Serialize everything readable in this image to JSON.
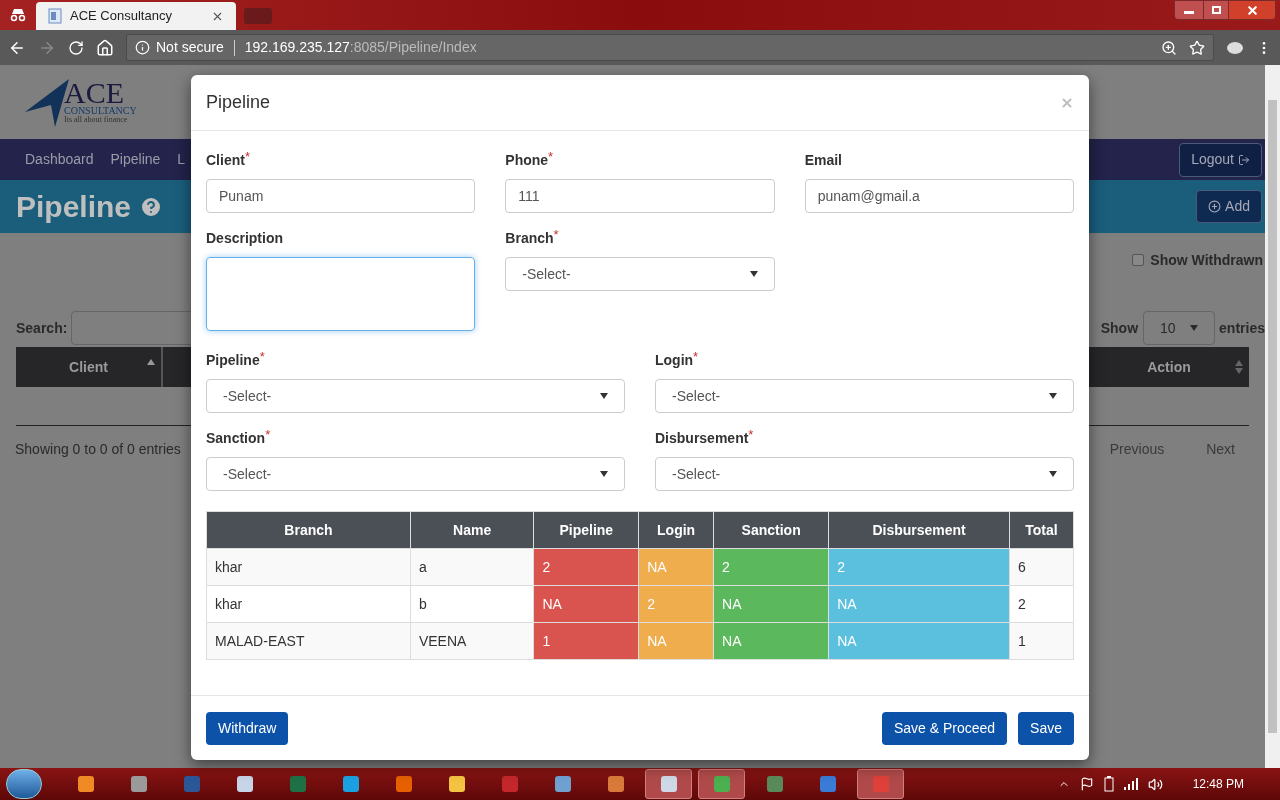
{
  "browser": {
    "tab_title": "ACE Consultancy",
    "security": "Not secure",
    "url_host": "192.169.235.127",
    "url_rest": ":8085/Pipeline/Index"
  },
  "page": {
    "logo": {
      "name": "ACE",
      "sub": "CONSULTANCY",
      "tagline": "Its all about finance"
    },
    "nav": [
      {
        "label": "Dashboard"
      },
      {
        "label": "Pipeline"
      },
      {
        "label": "L"
      }
    ],
    "logout": "Logout",
    "title": "Pipeline",
    "add": "Add",
    "show_withdrawn": {
      "label": "Show Withdrawn",
      "checked": false
    },
    "search_label": "Search:",
    "show_label": "Show",
    "page_size": "10",
    "entries_label": "entries",
    "columns": [
      "Client",
      "Action"
    ],
    "info": "Showing 0 to 0 of 0 entries",
    "previous": "Previous",
    "next": "Next"
  },
  "modal": {
    "title": "Pipeline",
    "field_rows": [
      [
        {
          "label": "Client",
          "mark": "*",
          "kind": "text",
          "value": "Punam",
          "focused": false
        },
        {
          "label": "Phone",
          "mark": "*",
          "kind": "text",
          "value": "111",
          "focused": false
        },
        {
          "label": "Email",
          "kind": "text",
          "value": "punam@gmail.a",
          "focused": false
        }
      ],
      [
        {
          "label": "Description",
          "kind": "textarea",
          "focused": true
        },
        {
          "label": "Branch",
          "mark": "*",
          "kind": "select",
          "value": "-Select-",
          "focused": false
        }
      ],
      [
        {
          "label": "Pipeline",
          "mark": "*",
          "kind": "select",
          "value": "-Select-",
          "focused": false
        },
        {
          "label": "Login",
          "mark": "*",
          "kind": "select",
          "value": "-Select-",
          "focused": false
        }
      ],
      [
        {
          "label": "Sanction",
          "mark": "*",
          "kind": "select",
          "value": "-Select-",
          "focused": false
        },
        {
          "label": "Disbursement",
          "mark": "*",
          "kind": "select",
          "value": "-Select-",
          "focused": false
        }
      ]
    ],
    "table": {
      "columns": [
        {
          "label": "Branch"
        },
        {
          "label": "Name"
        },
        {
          "label": "Pipeline",
          "color": "#d9534f"
        },
        {
          "label": "Login",
          "color": "#f0ad4e"
        },
        {
          "label": "Sanction",
          "color": "#5cb85c"
        },
        {
          "label": "Disbursement",
          "color": "#5bc0de"
        },
        {
          "label": "Total"
        }
      ],
      "rows": [
        [
          "khar",
          "a",
          "2",
          "NA",
          "2",
          "2",
          "6"
        ],
        [
          "khar",
          "b",
          "NA",
          "2",
          "NA",
          "NA",
          "2"
        ],
        [
          "MALAD-EAST",
          "VEENA",
          "1",
          "NA",
          "NA",
          "NA",
          "1"
        ]
      ]
    },
    "buttons": {
      "withdraw": "Withdraw",
      "save_proceed": "Save & Proceed",
      "save": "Save"
    }
  },
  "taskbar": {
    "apps": [
      {
        "running": false
      },
      {
        "running": false
      },
      {
        "running": false
      },
      {
        "running": false
      },
      {
        "running": false
      },
      {
        "running": false
      },
      {
        "running": false
      },
      {
        "running": false
      },
      {
        "running": false
      },
      {
        "running": false
      },
      {
        "running": false
      },
      {
        "running": true
      },
      {
        "running": true
      },
      {
        "running": false
      },
      {
        "running": false
      },
      {
        "running": true
      }
    ],
    "time": "12:48 PM"
  }
}
